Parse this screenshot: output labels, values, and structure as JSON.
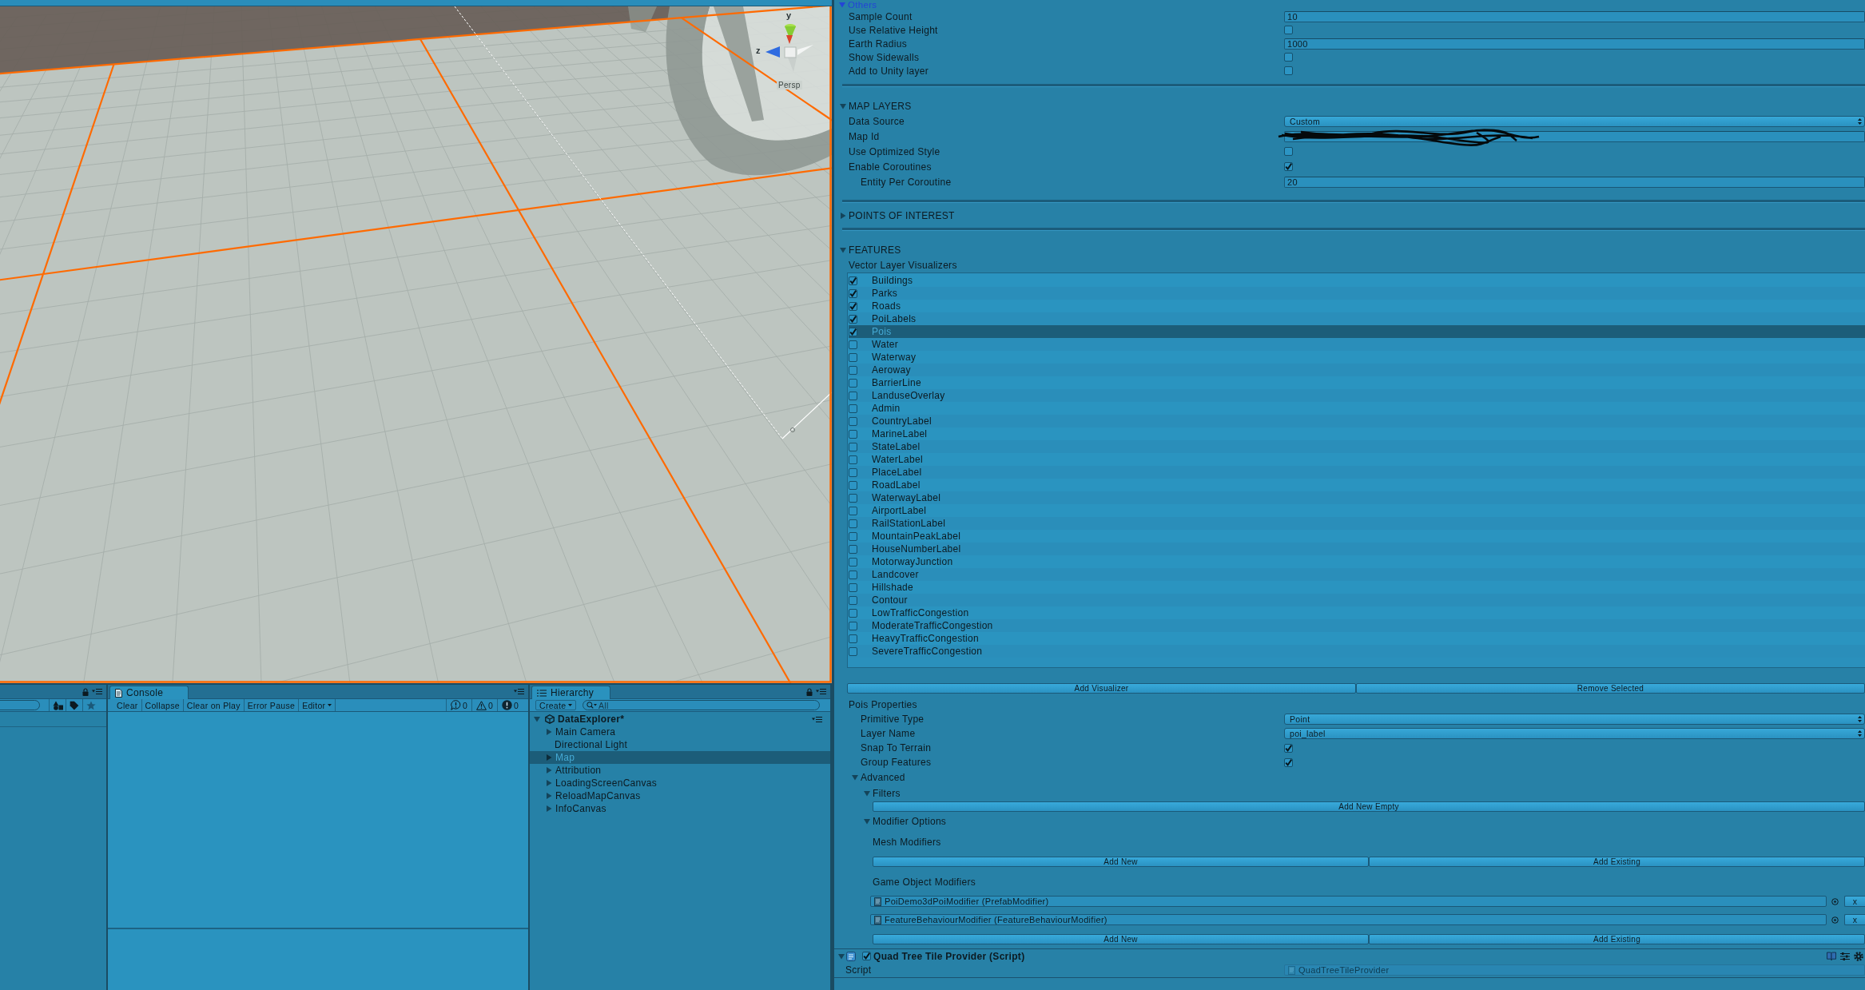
{
  "scene_view": {
    "gizmo": {
      "y_label": "y",
      "z_label": "z",
      "projection": "Persp"
    }
  },
  "inspector": {
    "sections": [
      {
        "title": "Others",
        "kind": "subgroup",
        "expanded": true,
        "rows": [
          {
            "label": "Sample Count",
            "kind": "number",
            "value": "10"
          },
          {
            "label": "Use Relative Height",
            "kind": "checkbox",
            "checked": false
          },
          {
            "label": "Earth Radius",
            "kind": "number",
            "value": "1000"
          },
          {
            "label": "Show Sidewalls",
            "kind": "checkbox",
            "checked": false
          },
          {
            "label": "Add to Unity layer",
            "kind": "checkbox",
            "checked": false
          }
        ]
      },
      {
        "title": "MAP LAYERS",
        "kind": "group",
        "expanded": true,
        "rows": [
          {
            "label": "Data Source",
            "kind": "dropdown",
            "value": "Custom"
          },
          {
            "label": "Map Id",
            "kind": "redacted"
          },
          {
            "label": "Use Optimized Style",
            "kind": "checkbox",
            "checked": false
          },
          {
            "label": "Enable Coroutines",
            "kind": "checkbox",
            "checked": true,
            "children": [
              {
                "label": "Entity Per Coroutine",
                "kind": "number",
                "value": "20"
              }
            ]
          }
        ]
      },
      {
        "title": "POINTS OF INTEREST",
        "kind": "group",
        "expanded": false
      }
    ],
    "features": {
      "title": "FEATURES",
      "expanded": true,
      "list_title": "Vector Layer Visualizers",
      "visualizers": [
        {
          "name": "Buildings",
          "checked": true,
          "selected": false
        },
        {
          "name": "Parks",
          "checked": true,
          "selected": false
        },
        {
          "name": "Roads",
          "checked": true,
          "selected": false
        },
        {
          "name": "PoiLabels",
          "checked": true,
          "selected": false
        },
        {
          "name": "Pois",
          "checked": true,
          "selected": true
        },
        {
          "name": "Water",
          "checked": false,
          "selected": false
        },
        {
          "name": "Waterway",
          "checked": false,
          "selected": false
        },
        {
          "name": "Aeroway",
          "checked": false,
          "selected": false
        },
        {
          "name": "BarrierLine",
          "checked": false,
          "selected": false
        },
        {
          "name": "LanduseOverlay",
          "checked": false,
          "selected": false
        },
        {
          "name": "Admin",
          "checked": false,
          "selected": false
        },
        {
          "name": "CountryLabel",
          "checked": false,
          "selected": false
        },
        {
          "name": "MarineLabel",
          "checked": false,
          "selected": false
        },
        {
          "name": "StateLabel",
          "checked": false,
          "selected": false
        },
        {
          "name": "WaterLabel",
          "checked": false,
          "selected": false
        },
        {
          "name": "PlaceLabel",
          "checked": false,
          "selected": false
        },
        {
          "name": "RoadLabel",
          "checked": false,
          "selected": false
        },
        {
          "name": "WaterwayLabel",
          "checked": false,
          "selected": false
        },
        {
          "name": "AirportLabel",
          "checked": false,
          "selected": false
        },
        {
          "name": "RailStationLabel",
          "checked": false,
          "selected": false
        },
        {
          "name": "MountainPeakLabel",
          "checked": false,
          "selected": false
        },
        {
          "name": "HouseNumberLabel",
          "checked": false,
          "selected": false
        },
        {
          "name": "MotorwayJunction",
          "checked": false,
          "selected": false
        },
        {
          "name": "Landcover",
          "checked": false,
          "selected": false
        },
        {
          "name": "Hillshade",
          "checked": false,
          "selected": false
        },
        {
          "name": "Contour",
          "checked": false,
          "selected": false
        },
        {
          "name": "LowTrafficCongestion",
          "checked": false,
          "selected": false
        },
        {
          "name": "ModerateTrafficCongestion",
          "checked": false,
          "selected": false
        },
        {
          "name": "HeavyTrafficCongestion",
          "checked": false,
          "selected": false
        },
        {
          "name": "SevereTrafficCongestion",
          "checked": false,
          "selected": false
        }
      ],
      "buttons": [
        "Add Visualizer",
        "Remove Selected"
      ],
      "properties": {
        "title": "Pois Properties",
        "rows": [
          {
            "label": "Primitive Type",
            "kind": "dropdown",
            "value": "Point"
          },
          {
            "label": "Layer Name",
            "kind": "dropdown",
            "value": "poi_label"
          },
          {
            "label": "Snap To Terrain",
            "kind": "checkbox",
            "checked": true
          },
          {
            "label": "Group Features",
            "kind": "checkbox",
            "checked": true
          }
        ],
        "advanced": {
          "title": "Advanced",
          "expanded": true,
          "filters": {
            "title": "Filters",
            "expanded": true,
            "button": "Add New Empty"
          },
          "modifier_options": {
            "title": "Modifier Options",
            "expanded": true,
            "mesh_modifiers": {
              "title": "Mesh Modifiers",
              "buttons": [
                "Add New",
                "Add Existing"
              ]
            },
            "game_object_modifiers": {
              "title": "Game Object Modifiers",
              "items": [
                {
                  "name": "PoiDemo3dPoiModifier (PrefabModifier)",
                  "remove": "x"
                },
                {
                  "name": "FeatureBehaviourModifier (FeatureBehaviourModifier)",
                  "remove": "x"
                }
              ],
              "buttons": [
                "Add New",
                "Add Existing"
              ]
            }
          }
        }
      }
    },
    "component": {
      "title": "Quad Tree Tile Provider (Script)",
      "expanded": true,
      "enabled": true,
      "rows": [
        {
          "label": "Script",
          "kind": "object",
          "value": "QuadTreeTileProvider",
          "disabled": true
        }
      ]
    }
  },
  "console": {
    "tab": {
      "label": "Console",
      "selected": true
    },
    "toolbar": [
      {
        "label": "Clear",
        "kind": "button"
      },
      {
        "label": "Collapse",
        "kind": "button"
      },
      {
        "label": "Clear on Play",
        "kind": "button"
      },
      {
        "label": "Error Pause",
        "kind": "button"
      },
      {
        "label": "Editor",
        "kind": "dropdown"
      }
    ],
    "counters": [
      {
        "kind": "info",
        "count": "0"
      },
      {
        "kind": "warning",
        "count": "0"
      },
      {
        "kind": "error",
        "count": "0"
      }
    ]
  },
  "hierarchy": {
    "tab": {
      "label": "Hierarchy",
      "selected": true
    },
    "create": "Create",
    "search": {
      "placeholder": "All"
    },
    "scene": {
      "name": "DataExplorer*",
      "expanded": true,
      "children": [
        {
          "name": "Main Camera",
          "expandable": true,
          "selected": false
        },
        {
          "name": "Directional Light",
          "expandable": false,
          "selected": false
        },
        {
          "name": "Map",
          "expandable": true,
          "selected": true
        },
        {
          "name": "Attribution",
          "expandable": true,
          "selected": false
        },
        {
          "name": "LoadingScreenCanvas",
          "expandable": true,
          "selected": false
        },
        {
          "name": "ReloadMapCanvas",
          "expandable": true,
          "selected": false
        },
        {
          "name": "InfoCanvas",
          "expandable": true,
          "selected": false
        }
      ]
    }
  }
}
